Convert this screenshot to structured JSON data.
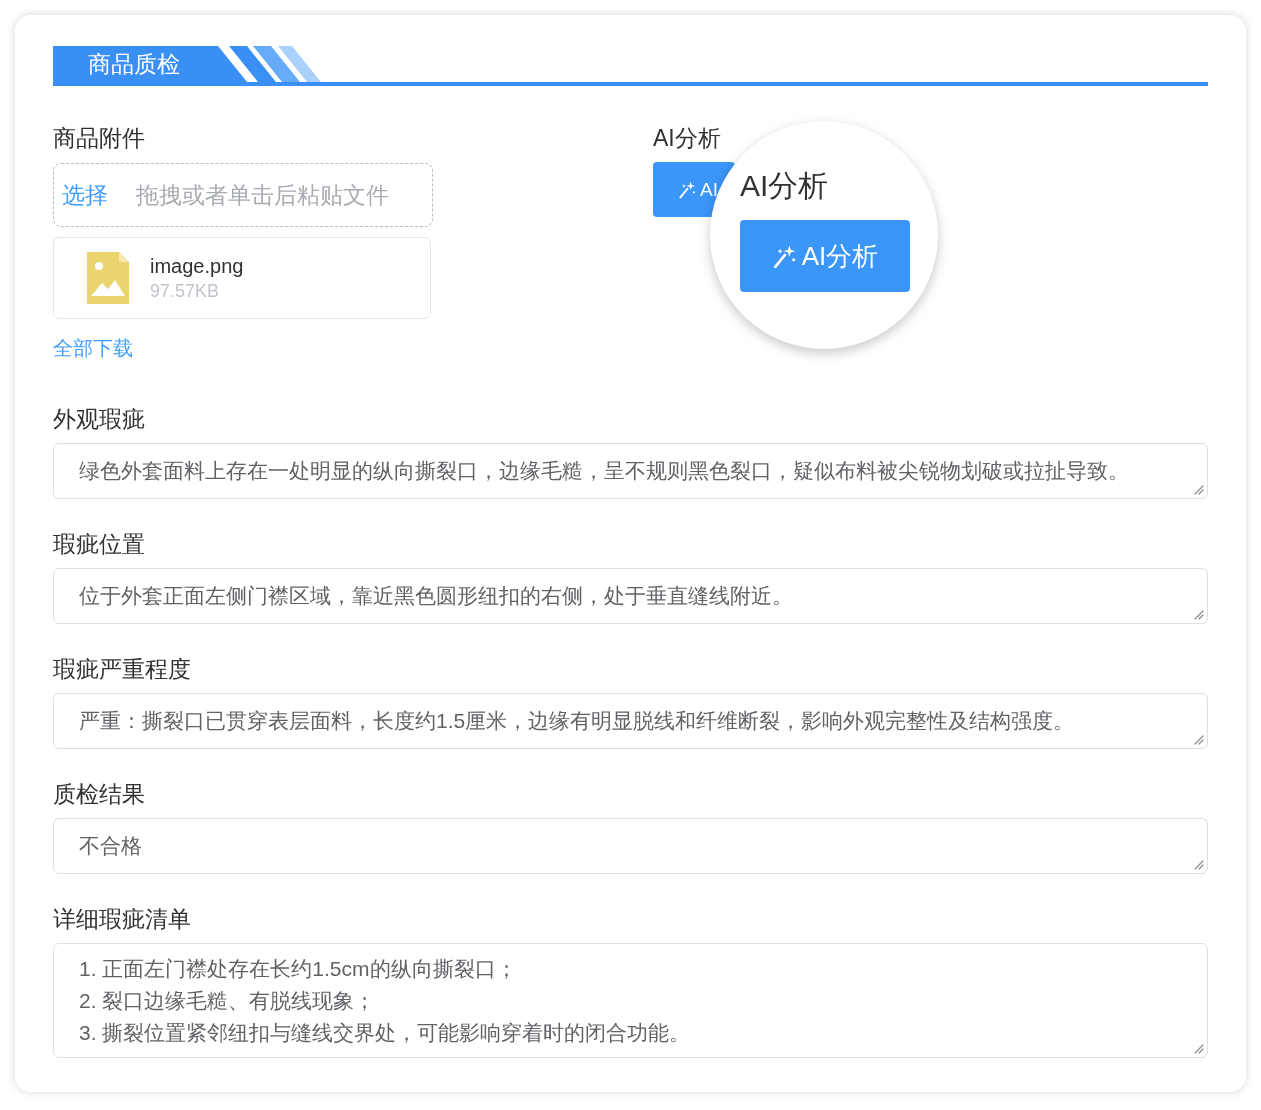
{
  "section": {
    "title": "商品质检"
  },
  "attachments": {
    "label": "商品附件",
    "upload": {
      "link": "选择",
      "hint": "拖拽或者单击后粘贴文件"
    },
    "files": [
      {
        "name": "image.png",
        "size": "97.57KB"
      }
    ],
    "download_all": "全部下载"
  },
  "ai_analysis": {
    "label": "AI分析",
    "button": "AI",
    "magnifier": {
      "label": "AI分析",
      "button": "AI分析"
    }
  },
  "fields": [
    {
      "label": "外观瑕疵",
      "value": "绿色外套面料上存在一处明显的纵向撕裂口，边缘毛糙，呈不规则黑色裂口，疑似布料被尖锐物划破或拉扯导致。"
    },
    {
      "label": "瑕疵位置",
      "value": "位于外套正面左侧门襟区域，靠近黑色圆形纽扣的右侧，处于垂直缝线附近。"
    },
    {
      "label": "瑕疵严重程度",
      "value": "严重：撕裂口已贯穿表层面料，长度约1.5厘米，边缘有明显脱线和纤维断裂，影响外观完整性及结构强度。"
    },
    {
      "label": "质检结果",
      "value": "不合格"
    },
    {
      "label": "详细瑕疵清单",
      "value": "1. 正面左门襟处存在长约1.5cm的纵向撕裂口；\n2. 裂口边缘毛糙、有脱线现象；\n3. 撕裂位置紧邻纽扣与缝线交界处，可能影响穿着时的闭合功能。"
    }
  ]
}
